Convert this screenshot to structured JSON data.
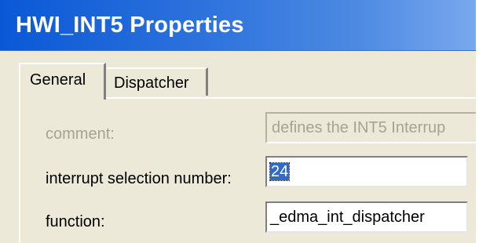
{
  "window": {
    "title": "HWI_INT5 Properties"
  },
  "tabs": [
    {
      "label": "General",
      "active": true
    },
    {
      "label": "Dispatcher",
      "active": false
    }
  ],
  "fields": {
    "comment": {
      "label": "comment:",
      "value": "defines the INT5 Interrup",
      "enabled": false
    },
    "interrupt_selection_number": {
      "label": "interrupt selection number:",
      "value": "24",
      "selected": true
    },
    "function": {
      "label": "function:",
      "value": "_edma_int_dispatcher"
    }
  },
  "colors": {
    "titlebar_start": "#0a58d6",
    "titlebar_end": "#79a8ee",
    "dialog_face": "#ece9d8",
    "disabled_text": "#a6a394",
    "selection": "#316ac5"
  }
}
